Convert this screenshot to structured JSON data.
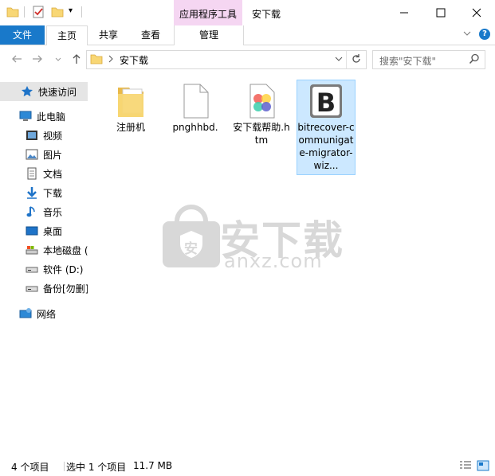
{
  "titlebar": {
    "context_tab_label": "应用程序工具",
    "window_title": "安下载",
    "minimize_label": "—",
    "maximize_label": "☐",
    "close_label": "✕"
  },
  "ribbon": {
    "tabs": [
      "文件",
      "主页",
      "共享",
      "查看",
      "管理"
    ],
    "collapse_label": "⌄",
    "help_label": "?"
  },
  "address": {
    "path_item": "安下载",
    "search_placeholder": "搜索\"安下载\""
  },
  "sidebar": {
    "items": [
      {
        "label": "快速访问",
        "icon": "quick-access-star-icon"
      },
      {
        "label": "此电脑",
        "icon": "computer-icon"
      },
      {
        "label": "视频",
        "icon": "video-folder-icon"
      },
      {
        "label": "图片",
        "icon": "pictures-folder-icon"
      },
      {
        "label": "文档",
        "icon": "documents-folder-icon"
      },
      {
        "label": "下载",
        "icon": "download-arrow-icon"
      },
      {
        "label": "音乐",
        "icon": "music-note-icon"
      },
      {
        "label": "桌面",
        "icon": "desktop-icon"
      },
      {
        "label": "本地磁盘 (",
        "icon": "local-disk-icon"
      },
      {
        "label": "软件 (D:)",
        "icon": "drive-icon"
      },
      {
        "label": "备份[勿删]",
        "icon": "drive-icon"
      },
      {
        "label": "网络",
        "icon": "network-icon"
      }
    ]
  },
  "files": [
    {
      "name": "注册机",
      "icon": "folder-icon"
    },
    {
      "name": "pnghhbd.",
      "icon": "blank-file-icon"
    },
    {
      "name": "安下载帮助.htm",
      "icon": "htm-file-icon"
    },
    {
      "name": "bitrecover-communigate-migrator-wiz...",
      "icon": "app-b-icon"
    }
  ],
  "watermark": {
    "title": "安下载",
    "domain": "anxz.com",
    "shield_char": "安"
  },
  "status": {
    "item_count": "4 个项目",
    "selection": "选中 1 个项目",
    "size": "11.7 MB"
  },
  "colors": {
    "accent": "#1979ca",
    "context_tab": "#f5d6f2",
    "selection_bg": "#cce8ff",
    "selection_border": "#99d1ff",
    "folder_yellow": "#f8d775"
  }
}
